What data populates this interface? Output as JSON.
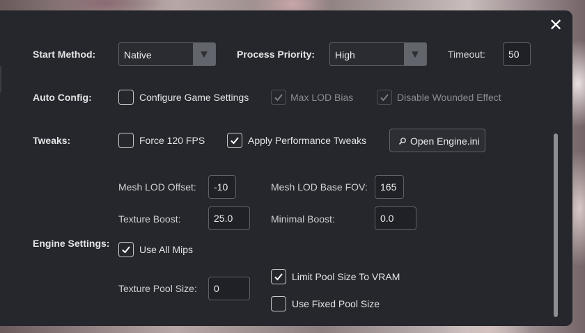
{
  "close_glyph": "✕",
  "start_method": {
    "label": "Start Method:",
    "value": "Native"
  },
  "process_priority": {
    "label": "Process Priority:",
    "value": "High"
  },
  "timeout": {
    "label": "Timeout:",
    "value": "50"
  },
  "auto_config": {
    "label": "Auto Config:",
    "configure_game_settings": {
      "label": "Configure Game Settings",
      "checked": false
    },
    "max_lod_bias": {
      "label": "Max LOD Bias",
      "checked": true,
      "disabled": true
    },
    "disable_wounded_effect": {
      "label": "Disable Wounded Effect",
      "checked": true,
      "disabled": true
    }
  },
  "tweaks": {
    "label": "Tweaks:",
    "force_120_fps": {
      "label": "Force 120 FPS",
      "checked": false
    },
    "apply_performance_tweaks": {
      "label": "Apply Performance Tweaks",
      "checked": true
    },
    "open_engine_ini": {
      "label": "Open Engine.ini",
      "icon": "search-icon"
    }
  },
  "engine_settings": {
    "label": "Engine Settings:",
    "mesh_lod_offset": {
      "label": "Mesh LOD Offset:",
      "value": "-10"
    },
    "mesh_lod_base_fov": {
      "label": "Mesh LOD Base FOV:",
      "value": "165"
    },
    "texture_boost": {
      "label": "Texture Boost:",
      "value": "25.0"
    },
    "minimal_boost": {
      "label": "Minimal Boost:",
      "value": "0.0"
    },
    "use_all_mips": {
      "label": "Use All Mips",
      "checked": true
    },
    "texture_pool_size": {
      "label": "Texture Pool Size:",
      "value": "0"
    },
    "limit_pool_size_to_vram": {
      "label": "Limit Pool Size To VRAM",
      "checked": true
    },
    "use_fixed_pool_size": {
      "label": "Use Fixed Pool Size",
      "checked": false
    }
  },
  "colors": {
    "panel_bg": "#25272d",
    "input_bg": "#1f2126",
    "border": "#5e6168",
    "text": "#e6e6e6",
    "disabled_text": "#8a8c90"
  }
}
